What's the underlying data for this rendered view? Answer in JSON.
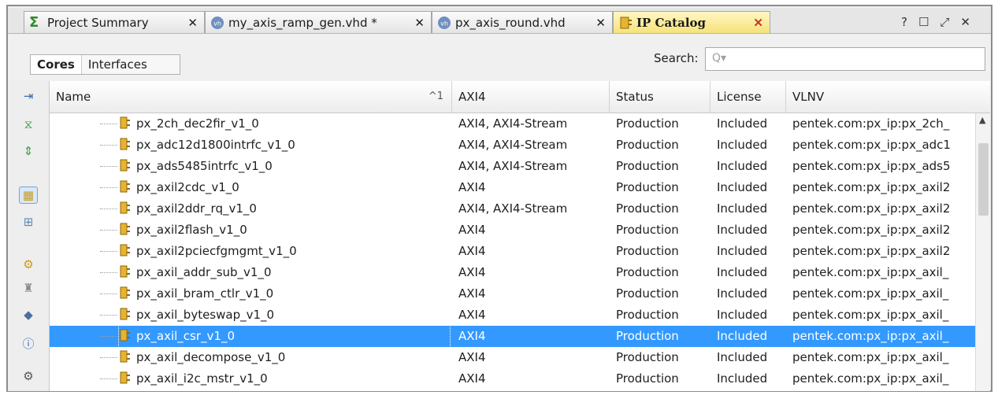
{
  "tabs": [
    {
      "label": "Project Summary",
      "icon": "sigma-icon"
    },
    {
      "label": "my_axis_ramp_gen.vhd *",
      "icon": "vhdl-file-icon"
    },
    {
      "label": "px_axis_round.vhd",
      "icon": "vhdl-file-icon"
    },
    {
      "label": "IP Catalog",
      "icon": "ip-core-icon",
      "active": true
    }
  ],
  "tab_close_glyph": "✕",
  "window_controls": {
    "help": "?",
    "maximize": "☐",
    "float": "⤢",
    "close": "✕"
  },
  "filter_tabs": {
    "cores": "Cores",
    "interfaces": "Interfaces"
  },
  "search": {
    "label": "Search:",
    "placeholder": "Q▾"
  },
  "columns": {
    "name": "Name",
    "sort_indicator": "^1",
    "axi4": "AXI4",
    "status": "Status",
    "license": "License",
    "vlnv": "VLNV"
  },
  "rows": [
    {
      "name": "px_2ch_dec2fir_v1_0",
      "axi4": "AXI4, AXI4-Stream",
      "status": "Production",
      "license": "Included",
      "vlnv": "pentek.com:px_ip:px_2ch_"
    },
    {
      "name": "px_adc12d1800intrfc_v1_0",
      "axi4": "AXI4, AXI4-Stream",
      "status": "Production",
      "license": "Included",
      "vlnv": "pentek.com:px_ip:px_adc1"
    },
    {
      "name": "px_ads5485intrfc_v1_0",
      "axi4": "AXI4, AXI4-Stream",
      "status": "Production",
      "license": "Included",
      "vlnv": "pentek.com:px_ip:px_ads5"
    },
    {
      "name": "px_axil2cdc_v1_0",
      "axi4": "AXI4",
      "status": "Production",
      "license": "Included",
      "vlnv": "pentek.com:px_ip:px_axil2"
    },
    {
      "name": "px_axil2ddr_rq_v1_0",
      "axi4": "AXI4, AXI4-Stream",
      "status": "Production",
      "license": "Included",
      "vlnv": "pentek.com:px_ip:px_axil2"
    },
    {
      "name": "px_axil2flash_v1_0",
      "axi4": "AXI4",
      "status": "Production",
      "license": "Included",
      "vlnv": "pentek.com:px_ip:px_axil2"
    },
    {
      "name": "px_axil2pciecfgmgmt_v1_0",
      "axi4": "AXI4",
      "status": "Production",
      "license": "Included",
      "vlnv": "pentek.com:px_ip:px_axil2"
    },
    {
      "name": "px_axil_addr_sub_v1_0",
      "axi4": "AXI4",
      "status": "Production",
      "license": "Included",
      "vlnv": "pentek.com:px_ip:px_axil_"
    },
    {
      "name": "px_axil_bram_ctlr_v1_0",
      "axi4": "AXI4",
      "status": "Production",
      "license": "Included",
      "vlnv": "pentek.com:px_ip:px_axil_"
    },
    {
      "name": "px_axil_byteswap_v1_0",
      "axi4": "AXI4",
      "status": "Production",
      "license": "Included",
      "vlnv": "pentek.com:px_ip:px_axil_"
    },
    {
      "name": "px_axil_csr_v1_0",
      "axi4": "AXI4",
      "status": "Production",
      "license": "Included",
      "vlnv": "pentek.com:px_ip:px_axil_",
      "selected": true
    },
    {
      "name": "px_axil_decompose_v1_0",
      "axi4": "AXI4",
      "status": "Production",
      "license": "Included",
      "vlnv": "pentek.com:px_ip:px_axil_"
    },
    {
      "name": "px_axil_i2c_mstr_v1_0",
      "axi4": "AXI4",
      "status": "Production",
      "license": "Included",
      "vlnv": "pentek.com:px_ip:px_axil_"
    }
  ],
  "left_toolbar": [
    "expand-all-icon",
    "collapse-all-icon",
    "expand-collapse-icon",
    "group-by-icon",
    "customize-ip-icon",
    "ip-settings-icon",
    "license-icon",
    "repository-icon",
    "ip-info-icon",
    "settings-gear-icon"
  ],
  "colors": {
    "selection": "#3399ff",
    "active_tab": "#f6e27a"
  }
}
